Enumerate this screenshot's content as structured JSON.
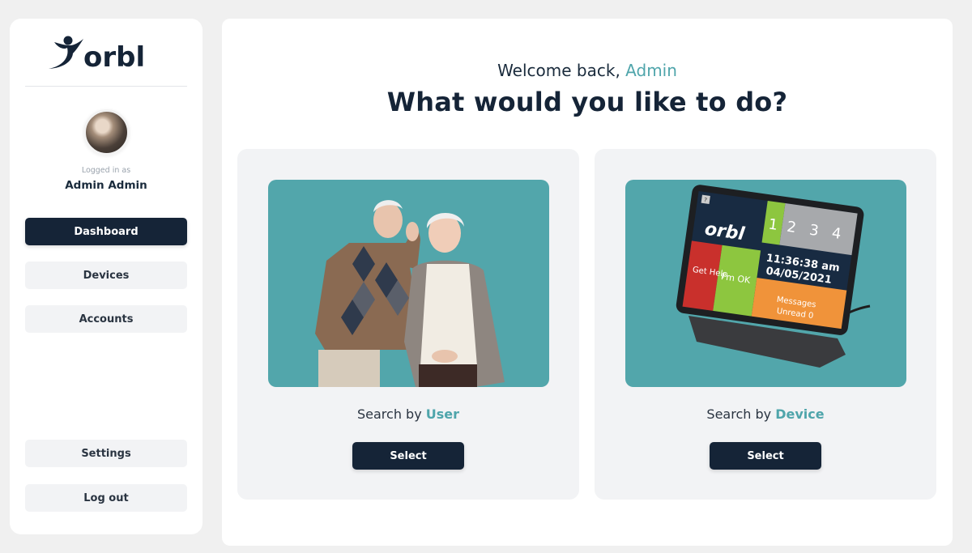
{
  "brand": {
    "name": "orbl",
    "primary_color": "#152437",
    "accent_color": "#4fa5ab"
  },
  "sidebar": {
    "logged_in_label": "Logged in as",
    "user_name": "Admin Admin",
    "nav": [
      {
        "label": "Dashboard",
        "active": true
      },
      {
        "label": "Devices",
        "active": false
      },
      {
        "label": "Accounts",
        "active": false
      }
    ],
    "bottom": [
      {
        "label": "Settings"
      },
      {
        "label": "Log out"
      }
    ]
  },
  "main": {
    "welcome_prefix": "Welcome back, ",
    "welcome_name": "Admin",
    "headline": "What would you like to do?",
    "cards": [
      {
        "image": "elderly-couple-photo",
        "caption_prefix": "Search by ",
        "caption_accent": "User",
        "button_label": "Select"
      },
      {
        "image": "orbl-tablet-device-photo",
        "caption_prefix": "Search by ",
        "caption_accent": "Device",
        "button_label": "Select",
        "device_screen": {
          "tiles": [
            "1",
            "2",
            "3",
            "4"
          ],
          "time": "11:36:38 am",
          "date": "04/05/2021",
          "get_help": "Get Help",
          "im_ok": "I'm OK",
          "messages": "Messages",
          "unread": "Unread 0",
          "help_key": "?"
        }
      }
    ]
  }
}
